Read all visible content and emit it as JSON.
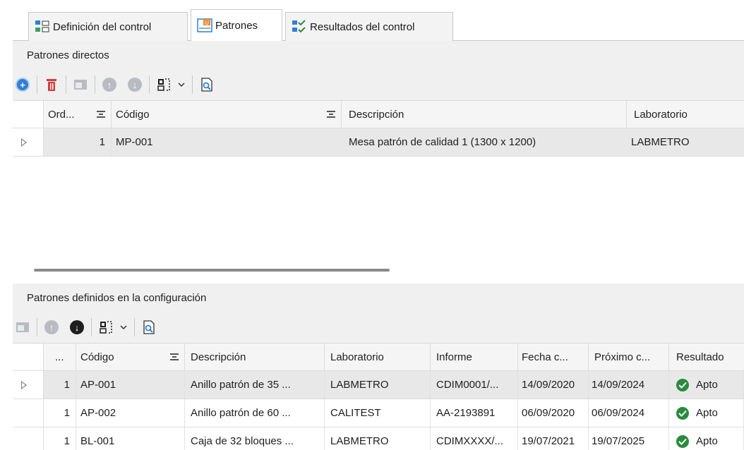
{
  "tabs": [
    {
      "label": "Definición del control",
      "icon": "tree-icon"
    },
    {
      "label": "Patrones",
      "icon": "ruler-icon"
    },
    {
      "label": "Resultados del control",
      "icon": "checklist-icon"
    }
  ],
  "direct": {
    "title": "Patrones directos",
    "columns": [
      "Ord...",
      "Código",
      "Descripción",
      "Laboratorio"
    ],
    "rows": [
      {
        "order": "1",
        "code": "MP-001",
        "description": "Mesa patrón de calidad 1 (1300 x 1200)",
        "lab": "LABMETRO"
      }
    ]
  },
  "config": {
    "title": "Patrones definidos en la configuración",
    "columns": [
      "...",
      "Código",
      "Descripción",
      "Laboratorio",
      "Informe",
      "Fecha c...",
      "Próximo c...",
      "Resultado"
    ],
    "rows": [
      {
        "n": "1",
        "code": "AP-001",
        "description": "Anillo patrón de 35 ...",
        "lab": "LABMETRO",
        "report": "CDIM0001/...",
        "date": "14/09/2020",
        "next": "14/09/2024",
        "result": "Apto"
      },
      {
        "n": "1",
        "code": "AP-002",
        "description": "Anillo patrón de 60 ...",
        "lab": "CALITEST",
        "report": "AA-2193891",
        "date": "06/09/2020",
        "next": "06/09/2024",
        "result": "Apto"
      },
      {
        "n": "1",
        "code": "BL-001",
        "description": "Caja de 32 bloques ...",
        "lab": "LABMETRO",
        "report": "CDIMXXXX/...",
        "date": "19/07/2021",
        "next": "19/07/2025",
        "result": "Apto"
      }
    ]
  },
  "colors": {
    "accent_blue": "#2f7fd6",
    "delete_red": "#d63a3a",
    "ok_green": "#2b8a3e",
    "disabled_gray": "#b8bcc2",
    "dark_icon": "#1e1e1e"
  }
}
